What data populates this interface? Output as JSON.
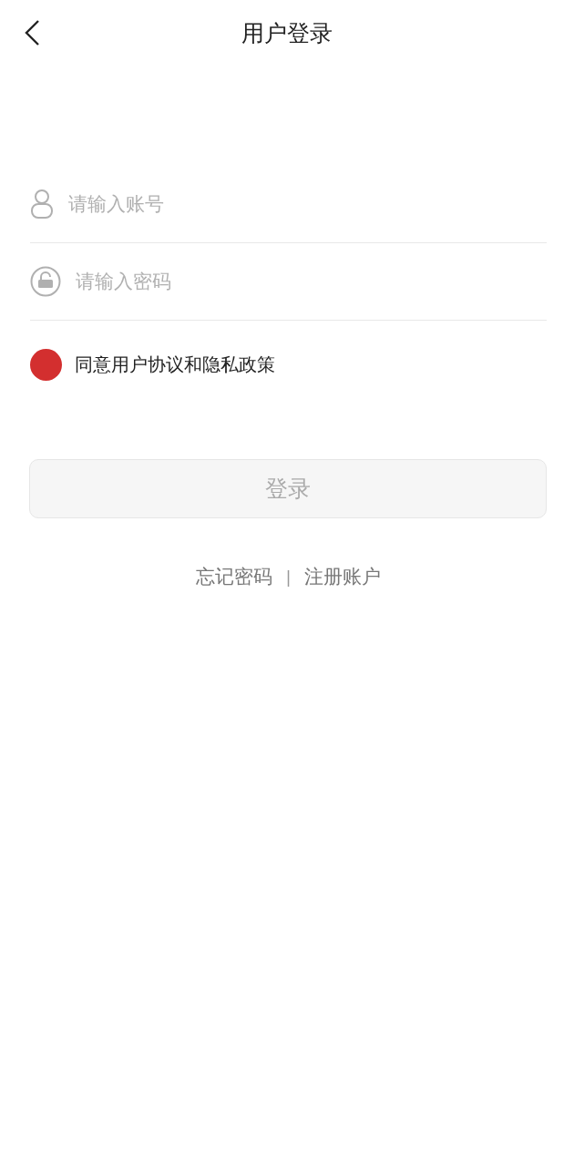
{
  "header": {
    "title": "用户登录"
  },
  "fields": [
    {
      "kind": "account",
      "placeholder": "请输入账号"
    },
    {
      "kind": "password",
      "placeholder": "请输入密码"
    }
  ],
  "agreement": {
    "label": "同意用户协议和隐私政策",
    "checked": true
  },
  "login_button": {
    "label": "登录",
    "disabled": true
  },
  "links": [
    {
      "label": "忘记密码"
    },
    {
      "label": "注册账户"
    }
  ],
  "separator": "|"
}
